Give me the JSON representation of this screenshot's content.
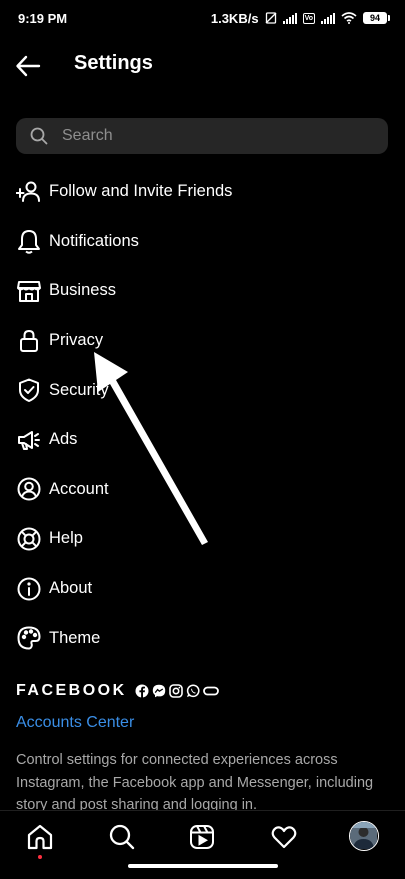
{
  "status": {
    "time": "9:19 PM",
    "speed": "1.3KB/s",
    "battery": "94",
    "volte": "Vo"
  },
  "header": {
    "title": "Settings"
  },
  "search": {
    "placeholder": "Search"
  },
  "menu": {
    "items": [
      {
        "label": "Follow and Invite Friends",
        "icon": "add-person-icon"
      },
      {
        "label": "Notifications",
        "icon": "bell-icon"
      },
      {
        "label": "Business",
        "icon": "store-icon"
      },
      {
        "label": "Privacy",
        "icon": "lock-icon"
      },
      {
        "label": "Security",
        "icon": "shield-icon"
      },
      {
        "label": "Ads",
        "icon": "megaphone-icon"
      },
      {
        "label": "Account",
        "icon": "account-icon"
      },
      {
        "label": "Help",
        "icon": "lifebuoy-icon"
      },
      {
        "label": "About",
        "icon": "info-icon"
      },
      {
        "label": "Theme",
        "icon": "palette-icon"
      }
    ]
  },
  "facebook": {
    "wordmark": "FACEBOOK",
    "accounts_center": "Accounts Center",
    "description": "Control settings for connected experiences across Instagram, the Facebook app and Messenger, including story and post sharing and logging in."
  },
  "colors": {
    "background": "#000000",
    "link": "#3a8ee6",
    "muted": "#a8a8a8",
    "search_bg": "#262626"
  }
}
